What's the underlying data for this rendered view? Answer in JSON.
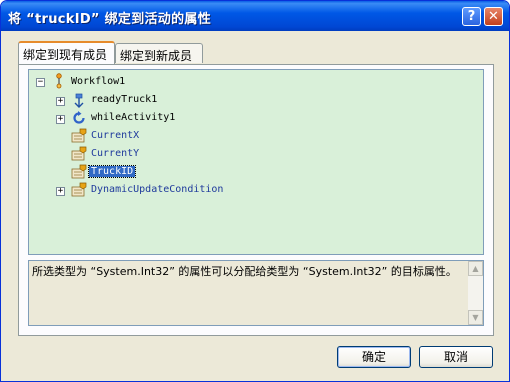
{
  "window": {
    "title": "将 “truckID” 绑定到活动的属性"
  },
  "titlebar_buttons": {
    "help": "?",
    "close": "✕"
  },
  "tabs": [
    {
      "label": "绑定到现有成员",
      "selected": true
    },
    {
      "label": "绑定到新成员",
      "selected": false
    }
  ],
  "tree": {
    "root": "Workflow1",
    "children": [
      {
        "label": "readyTruck1",
        "icon": "activity-icon",
        "expandable": true
      },
      {
        "label": "whileActivity1",
        "icon": "while-loop-icon",
        "expandable": true
      },
      {
        "label": "CurrentX",
        "icon": "property-icon",
        "expandable": false
      },
      {
        "label": "CurrentY",
        "icon": "property-icon",
        "expandable": false
      },
      {
        "label": "TruckID",
        "icon": "property-icon",
        "expandable": false,
        "selected": true
      },
      {
        "label": "DynamicUpdateCondition",
        "icon": "property-icon",
        "expandable": true
      }
    ]
  },
  "description": "所选类型为 “System.Int32” 的属性可以分配给类型为 “System.Int32” 的目标属性。",
  "buttons": {
    "ok": "确定",
    "cancel": "取消"
  },
  "colors": {
    "tree_bg": "#d9f0d9",
    "selection": "#316ac5",
    "titlebar": "#0058e6"
  }
}
